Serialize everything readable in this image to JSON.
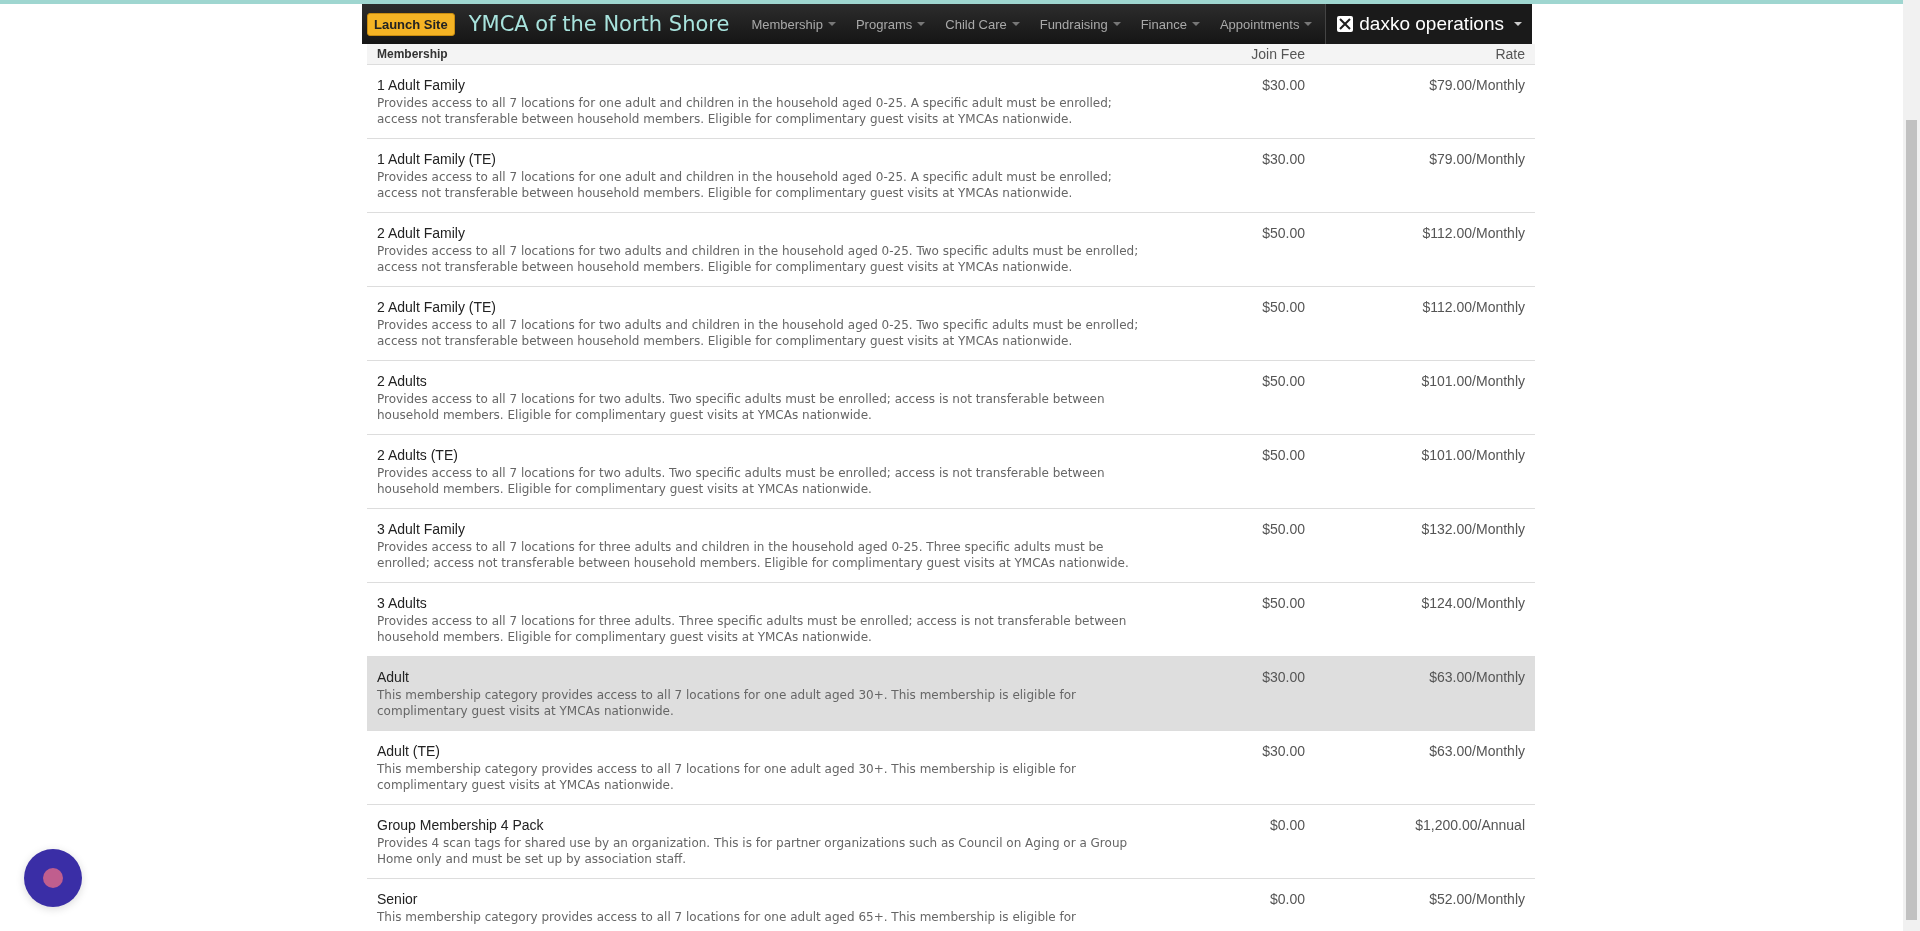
{
  "navbar": {
    "launch_button": "Launch Site",
    "site_title": "YMCA of the North Shore",
    "menu": [
      {
        "label": "Membership"
      },
      {
        "label": "Programs"
      },
      {
        "label": "Child Care"
      },
      {
        "label": "Fundraising"
      },
      {
        "label": "Finance"
      },
      {
        "label": "Appointments"
      }
    ],
    "product": "daxko operations"
  },
  "table": {
    "columns": [
      "Membership",
      "Join Fee",
      "Rate"
    ],
    "rows": [
      {
        "name": "1 Adult Family",
        "description": "Provides access to all 7 locations for one adult and children in the household aged 0-25. A specific adult must be enrolled; access not transferable between household members. Eligible for complimentary guest visits at YMCAs nationwide.",
        "join_fee": "$30.00",
        "rate": "$79.00/Monthly",
        "highlighted": false
      },
      {
        "name": "1 Adult Family (TE)",
        "description": "Provides access to all 7 locations for one adult and children in the household aged 0-25. A specific adult must be enrolled; access not transferable between household members. Eligible for complimentary guest visits at YMCAs nationwide.",
        "join_fee": "$30.00",
        "rate": "$79.00/Monthly",
        "highlighted": false
      },
      {
        "name": "2 Adult Family",
        "description": "Provides access to all 7 locations for two adults and children in the household aged 0-25. Two specific adults must be enrolled; access not transferable between household members. Eligible for complimentary guest visits at YMCAs nationwide.",
        "join_fee": "$50.00",
        "rate": "$112.00/Monthly",
        "highlighted": false
      },
      {
        "name": "2 Adult Family (TE)",
        "description": "Provides access to all 7 locations for two adults and children in the household aged 0-25. Two specific adults must be enrolled; access not transferable between household members. Eligible for complimentary guest visits at YMCAs nationwide.",
        "join_fee": "$50.00",
        "rate": "$112.00/Monthly",
        "highlighted": false
      },
      {
        "name": "2 Adults",
        "description": "Provides access to all 7 locations for two adults. Two specific adults must be enrolled; access is not transferable between household members. Eligible for complimentary guest visits at YMCAs nationwide.",
        "join_fee": "$50.00",
        "rate": "$101.00/Monthly",
        "highlighted": false
      },
      {
        "name": "2 Adults (TE)",
        "description": "Provides access to all 7 locations for two adults. Two specific adults must be enrolled; access is not transferable between household members. Eligible for complimentary guest visits at YMCAs nationwide.",
        "join_fee": "$50.00",
        "rate": "$101.00/Monthly",
        "highlighted": false
      },
      {
        "name": "3 Adult Family",
        "description": "Provides access to all 7 locations for three adults and children in the household aged 0-25. Three specific adults must be enrolled; access not transferable between household members. Eligible for complimentary guest visits at YMCAs nationwide.",
        "join_fee": "$50.00",
        "rate": "$132.00/Monthly",
        "highlighted": false
      },
      {
        "name": "3 Adults",
        "description": "Provides access to all 7 locations for three adults. Three specific adults must be enrolled; access is not transferable between household members. Eligible for complimentary guest visits at YMCAs nationwide.",
        "join_fee": "$50.00",
        "rate": "$124.00/Monthly",
        "highlighted": false
      },
      {
        "name": "Adult",
        "description": "This membership category provides access to all 7 locations for one adult aged 30+. This membership is eligible for complimentary guest visits at YMCAs nationwide.",
        "join_fee": "$30.00",
        "rate": "$63.00/Monthly",
        "highlighted": true
      },
      {
        "name": "Adult (TE)",
        "description": "This membership category provides access to all 7 locations for one adult aged 30+. This membership is eligible for complimentary guest visits at YMCAs nationwide.",
        "join_fee": "$30.00",
        "rate": "$63.00/Monthly",
        "highlighted": false
      },
      {
        "name": "Group Membership 4 Pack",
        "description": "Provides 4 scan tags for shared use by an organization. This is for partner organizations such as Council on Aging or a Group Home only and must be set up by association staff.",
        "join_fee": "$0.00",
        "rate": "$1,200.00/Annual",
        "highlighted": false
      },
      {
        "name": "Senior",
        "description": "This membership category provides access to all 7 locations for one adult aged 65+. This membership is eligible for",
        "join_fee": "$0.00",
        "rate": "$52.00/Monthly",
        "highlighted": false
      }
    ]
  }
}
